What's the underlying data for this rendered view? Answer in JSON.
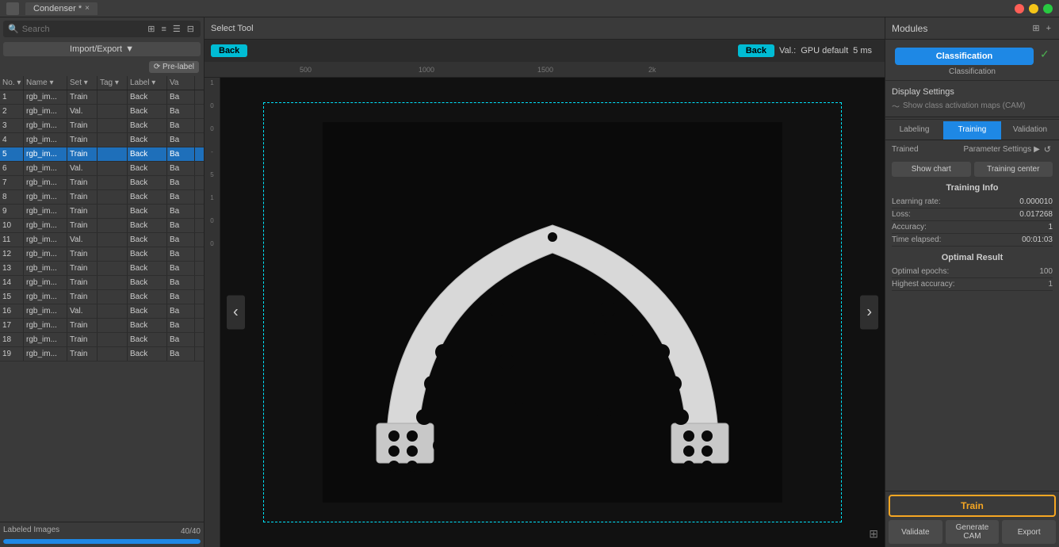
{
  "window": {
    "title": "Condenser *",
    "tab_label": "Condenser *"
  },
  "toolbar": {
    "tool_label": "Select Tool"
  },
  "search": {
    "placeholder": "Search"
  },
  "import_export": {
    "label": "Import/Export",
    "dropdown_icon": "▼"
  },
  "pre_label": {
    "label": "⟳ Pre-label"
  },
  "table": {
    "headers": [
      "No.",
      "Name",
      "Set",
      "Tag",
      "Label",
      "Va"
    ],
    "rows": [
      {
        "no": 1,
        "name": "rgb_im...",
        "set": "Train",
        "tag": "",
        "label": "Back",
        "val": "Ba"
      },
      {
        "no": 2,
        "name": "rgb_im...",
        "set": "Val.",
        "tag": "",
        "label": "Back",
        "val": "Ba"
      },
      {
        "no": 3,
        "name": "rgb_im...",
        "set": "Train",
        "tag": "",
        "label": "Back",
        "val": "Ba"
      },
      {
        "no": 4,
        "name": "rgb_im...",
        "set": "Train",
        "tag": "",
        "label": "Back",
        "val": "Ba"
      },
      {
        "no": 5,
        "name": "rgb_im...",
        "set": "Train",
        "tag": "",
        "label": "Back",
        "val": "Ba",
        "selected": true
      },
      {
        "no": 6,
        "name": "rgb_im...",
        "set": "Val.",
        "tag": "",
        "label": "Back",
        "val": "Ba"
      },
      {
        "no": 7,
        "name": "rgb_im...",
        "set": "Train",
        "tag": "",
        "label": "Back",
        "val": "Ba"
      },
      {
        "no": 8,
        "name": "rgb_im...",
        "set": "Train",
        "tag": "",
        "label": "Back",
        "val": "Ba"
      },
      {
        "no": 9,
        "name": "rgb_im...",
        "set": "Train",
        "tag": "",
        "label": "Back",
        "val": "Ba"
      },
      {
        "no": 10,
        "name": "rgb_im...",
        "set": "Train",
        "tag": "",
        "label": "Back",
        "val": "Ba"
      },
      {
        "no": 11,
        "name": "rgb_im...",
        "set": "Val.",
        "tag": "",
        "label": "Back",
        "val": "Ba"
      },
      {
        "no": 12,
        "name": "rgb_im...",
        "set": "Train",
        "tag": "",
        "label": "Back",
        "val": "Ba"
      },
      {
        "no": 13,
        "name": "rgb_im...",
        "set": "Train",
        "tag": "",
        "label": "Back",
        "val": "Ba"
      },
      {
        "no": 14,
        "name": "rgb_im...",
        "set": "Train",
        "tag": "",
        "label": "Back",
        "val": "Ba"
      },
      {
        "no": 15,
        "name": "rgb_im...",
        "set": "Train",
        "tag": "",
        "label": "Back",
        "val": "Ba"
      },
      {
        "no": 16,
        "name": "rgb_im...",
        "set": "Val.",
        "tag": "",
        "label": "Back",
        "val": "Ba"
      },
      {
        "no": 17,
        "name": "rgb_im...",
        "set": "Train",
        "tag": "",
        "label": "Back",
        "val": "Ba"
      },
      {
        "no": 18,
        "name": "rgb_im...",
        "set": "Train",
        "tag": "",
        "label": "Back",
        "val": "Ba"
      },
      {
        "no": 19,
        "name": "rgb_im...",
        "set": "Train",
        "tag": "",
        "label": "Back",
        "val": "Ba"
      }
    ]
  },
  "bottom_panel": {
    "labeled_label": "Labeled Images",
    "progress_text": "40/40",
    "progress_pct": 100
  },
  "image_bar": {
    "left_label": "Back",
    "right_label": "Back",
    "val_prefix": "Val.:",
    "gpu_label": "GPU default",
    "ms_label": "5 ms"
  },
  "ruler": {
    "ticks": [
      "500",
      "1000",
      "1500",
      "2k"
    ]
  },
  "modules": {
    "title": "Modules",
    "classification_btn": "Classification",
    "classification_label": "Classification",
    "check_mark": "✓",
    "display_settings": "Display Settings",
    "cam_label": "Show class activation maps (CAM)",
    "tabs": [
      "Labeling",
      "Training",
      "Validation"
    ],
    "active_tab": "Training",
    "trained_label": "Trained",
    "param_settings": "Parameter Settings",
    "show_chart": "Show chart",
    "training_center": "Training center",
    "training_info_title": "Training Info",
    "training_info": {
      "learning_rate_label": "Learning rate:",
      "learning_rate_val": "0.000010",
      "loss_label": "Loss:",
      "loss_val": "0.017268",
      "accuracy_label": "Accuracy:",
      "accuracy_val": "1",
      "time_elapsed_label": "Time elapsed:",
      "time_elapsed_val": "00:01:03"
    },
    "optimal_result_title": "Optimal Result",
    "optimal_result": {
      "epochs_label": "Optimal epochs:",
      "epochs_val": "100",
      "accuracy_label": "Highest accuracy:",
      "accuracy_val": "1"
    },
    "train_btn": "Train",
    "validate_btn": "Validate",
    "generate_cam_btn": "Generate CAM",
    "export_btn": "Export"
  },
  "detection_text": "Train Back"
}
